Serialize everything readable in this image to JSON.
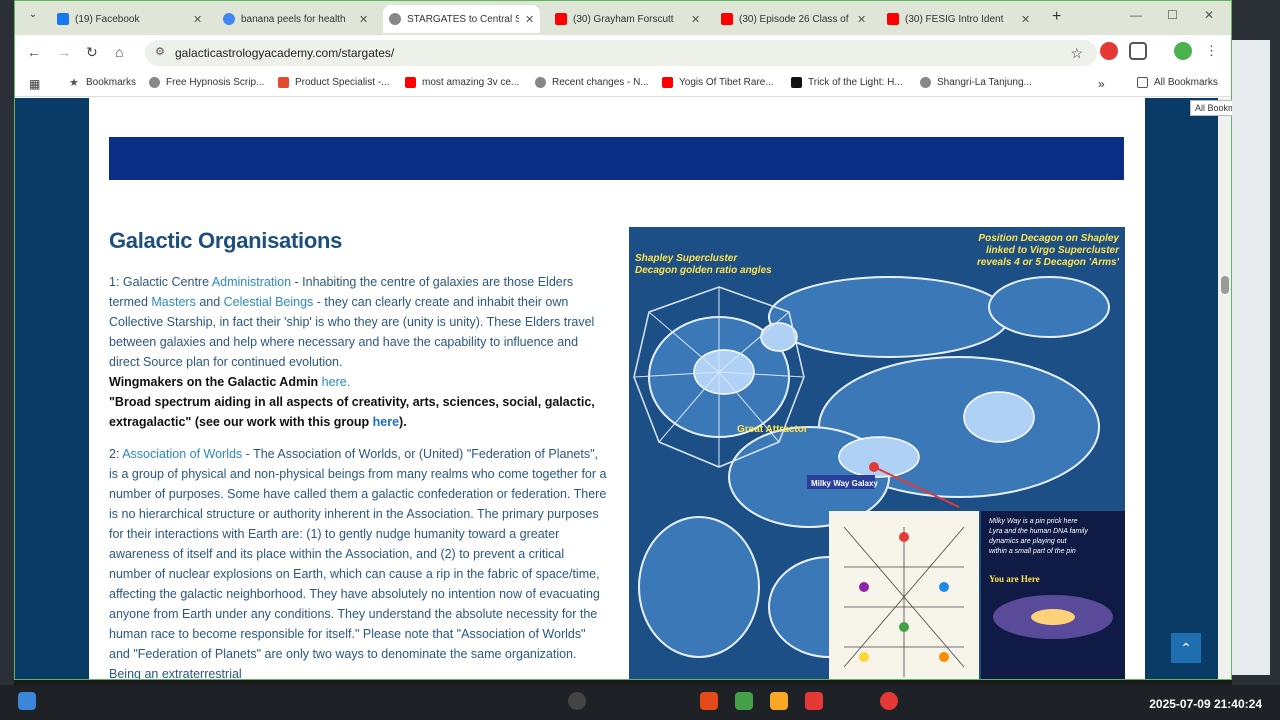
{
  "tabs": [
    {
      "title": "(19) Facebook",
      "color": "#1877f2"
    },
    {
      "title": "banana peels for health",
      "color": "#4285f4"
    },
    {
      "title": "STARGATES to Central S",
      "color": "#888888"
    },
    {
      "title": "(30) Grayham Forscutt",
      "color": "#ff0000"
    },
    {
      "title": "(30) Episode 26 Class of",
      "color": "#ff0000"
    },
    {
      "title": "(30) FESIG Intro Ident",
      "color": "#ff0000"
    }
  ],
  "address": {
    "url": "galacticastrologyacademy.com/stargates/"
  },
  "bookmarks": [
    {
      "label": "Bookmarks",
      "color": "#555555"
    },
    {
      "label": "Free Hypnosis Scrip...",
      "color": "#666666"
    },
    {
      "label": "Product Specialist -...",
      "color": "#e34b2e"
    },
    {
      "label": "most amazing 3v ce...",
      "color": "#ff0000"
    },
    {
      "label": "Recent changes - N...",
      "color": "#666666"
    },
    {
      "label": "Yogis Of Tibet Rare...",
      "color": "#ff0000"
    },
    {
      "label": "Trick of the Light: H...",
      "color": "#111111"
    },
    {
      "label": "Shangri-La Tanjung...",
      "color": "#666666"
    }
  ],
  "all_bookmarks": "All Bookmarks",
  "tooltip": "All Bookmarks",
  "heading": "Galactic Organisations",
  "p1": {
    "n": "1:  Galactic Centre ",
    "admin": "Administration",
    "t1": " -   Inhabiting the centre of galaxies are those Elders termed ",
    "masters": "Masters",
    "and": " and ",
    "celestial": "Celestial Beings",
    "t2": " - they can clearly create and inhabit their own Collective Starship, in fact their 'ship' is who they are (unity is unity). These Elders travel between galaxies and help where necessary and have the capability to influence and direct Source plan for continued evolution.",
    "wm": "Wingmakers on the Galactic Admin ",
    "here1": "here.",
    "bs": "\"Broad spectrum aiding in all aspects of creativity, arts, sciences, social, galactic, extragalactic\" (see our work with this group ",
    "here2": "here",
    "close": ")."
  },
  "p2": {
    "n": "2:  ",
    "aow": "Association of Worlds",
    "t": "  -  The Association of Worlds, or (United) \"Federation of Planets\", is a group of physical and non-physical beings from many realms who come together for a number of purposes. Some have called them a galactic confederation or federation. There is no hierarchical structure or authority inherent in the Association. The primary purposes for their interactions with Earth are: (1) to gently nudge humanity toward a greater awareness of itself and its place within the Association, and (2) to prevent a critical number of nuclear explosions on Earth, which can cause a rip in the fabric of space/time, affecting the galactic neighborhood. They have absolutely no intention now of evacuating anyone from Earth under any conditions. They understand the absolute necessity for the human race to become responsible for itself.\"  Please note that \"Association of Worlds\" and \"Federation of Planets\" are only two ways to denominate the same organization. Being an extraterrestrial"
  },
  "graphic": {
    "top_left": "Shapley Supercluster\nDecagon golden ratio angles",
    "top_right": "Position Decagon on Shapley\nlinked to Virgo Supercluster\nreveals 4 or 5 Decagon 'Arms'",
    "great_attractor": "Great Attractor",
    "milky_way": "Milky Way Galaxy",
    "pin": "Milky Way is a pin prick here\nLyra and the human DNA family\ndynamics are playing out\nwithin a small part of the pin",
    "you_are_here": "You are Here"
  },
  "clock": "2025-07-09  21:40:24"
}
